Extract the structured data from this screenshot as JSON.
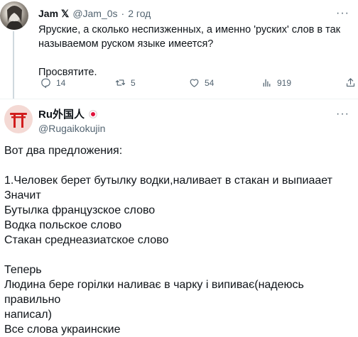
{
  "parent_tweet": {
    "author_name": "Jam",
    "verified_mark": "𝕏",
    "handle": "@Jam_0s",
    "separator": "·",
    "time": "2 год",
    "text_lines": [
      "Яруские, а сколько неспизженных, а именно 'руских' слов в так",
      "называемом руском языке имеется?"
    ],
    "text_line_after_gap": "Просвятите.",
    "actions": {
      "replies": "14",
      "retweets": "5",
      "likes": "54",
      "views": "919"
    },
    "more_label": "···"
  },
  "reply_tweet": {
    "author_name": "Ru外国人",
    "handle": "@Rugaikokujin",
    "more_label": "···",
    "lines": [
      "Вот два предложения:",
      "",
      "1.Человек берет бутылку водки,наливает в стакан и выпиаает",
      "Значит",
      "Бутылка французское слово",
      "Водка польское слово",
      "Стакан среднеазиатское слово",
      "",
      "Теперь",
      "Людина бере горілки наливає в чарку і випиває(надеюсь правильно",
      "написал)",
      "Все слова украинские"
    ]
  },
  "icons": {
    "reply": "reply-icon",
    "retweet": "retweet-icon",
    "like": "heart-icon",
    "views": "views-icon",
    "share": "share-icon",
    "brand_accent": "#e0103a"
  }
}
